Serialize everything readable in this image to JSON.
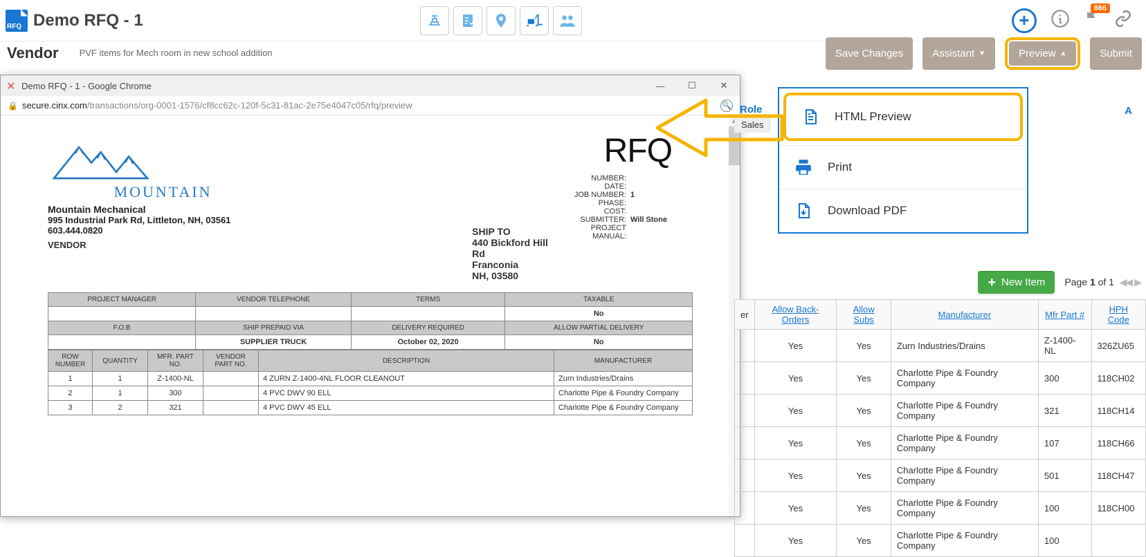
{
  "header": {
    "title": "Demo RFQ - 1",
    "badge_count": "866"
  },
  "sub": {
    "vendor_label": "Vendor",
    "description": "PVF items for Mech room in new school addition"
  },
  "buttons": {
    "save": "Save Changes",
    "assistant": "Assistant",
    "preview": "Preview",
    "submit": "Submit"
  },
  "dropdown": {
    "html_preview": "HTML Preview",
    "print": "Print",
    "download_pdf": "Download PDF"
  },
  "popup": {
    "title": "Demo RFQ - 1 - Google Chrome",
    "url_host": "secure.cinx.com",
    "url_path": "/transactions/org-0001-1576/cf8cc62c-120f-5c31-81ac-2e75e4047c05/rfq/preview"
  },
  "doc": {
    "logo_text": "MOUNTAIN",
    "company_name": "Mountain Mechanical",
    "company_addr": "995 Industrial Park Rd, Littleton, NH, 03561   603.444.0820",
    "vendor_label": "VENDOR",
    "shipto_label": "SHIP TO",
    "ship_addr": "440 Bickford Hill Rd",
    "ship_city": "Franconia",
    "ship_state": "NH, 03580",
    "rfq_heading": "RFQ",
    "fields": {
      "number_lbl": "NUMBER:",
      "date_lbl": "DATE:",
      "job_lbl": "JOB NUMBER:",
      "job_val": "1",
      "phase_lbl": "PHASE:",
      "cost_lbl": "COST:",
      "submitter_lbl": "SUBMITTER:",
      "submitter_val": "Will Stone",
      "manual_lbl": "PROJECT MANUAL:"
    },
    "row1": {
      "h1": "PROJECT MANAGER",
      "h2": "VENDOR TELEPHONE",
      "h3": "TERMS",
      "h4": "TAXABLE",
      "v4": "No"
    },
    "row2": {
      "h1": "F.O.B",
      "h2": "SHIP PREPAID VIA",
      "h3": "DELIVERY REQUIRED",
      "h4": "ALLOW PARTIAL DELIVERY",
      "v2": "SUPPLIER TRUCK",
      "v3": "October 02, 2020",
      "v4": "No"
    },
    "cols": {
      "c1": "ROW NUMBER",
      "c2": "QUANTITY",
      "c3": "MFR. PART NO.",
      "c4": "VENDOR PART NO.",
      "c5": "DESCRIPTION",
      "c6": "MANUFACTURER"
    },
    "rows": [
      {
        "n": "1",
        "q": "1",
        "mfr": "Z-1400-NL",
        "vp": "",
        "desc": "4 ZURN Z-1400-4NL FLOOR CLEANOUT",
        "man": "Zurn Industries/Drains"
      },
      {
        "n": "2",
        "q": "1",
        "mfr": "300",
        "vp": "",
        "desc": "4 PVC DWV 90 ELL",
        "man": "Charlotte Pipe & Foundry Company"
      },
      {
        "n": "3",
        "q": "2",
        "mfr": "321",
        "vp": "",
        "desc": "4 PVC DWV 45 ELL",
        "man": "Charlotte Pipe & Foundry Company"
      }
    ]
  },
  "grid_area": {
    "role_label": "Role",
    "sales_tab": "Sales",
    "acol": "A",
    "new_item": "New Item",
    "page_label_pre": "Page ",
    "page_num": "1",
    "page_of": " of 1",
    "headers": {
      "cut": "er",
      "backorders": "Allow Back-Orders",
      "subs": "Allow Subs",
      "manufacturer": "Manufacturer",
      "mfrpart": "Mfr Part #",
      "hph": "HPH Code"
    },
    "rows": [
      {
        "bo": "Yes",
        "sub": "Yes",
        "man": "Zurn Industries/Drains",
        "part": "Z-1400-NL",
        "hph": "326ZU65"
      },
      {
        "bo": "Yes",
        "sub": "Yes",
        "man": "Charlotte Pipe & Foundry Company",
        "part": "300",
        "hph": "118CH02"
      },
      {
        "bo": "Yes",
        "sub": "Yes",
        "man": "Charlotte Pipe & Foundry Company",
        "part": "321",
        "hph": "118CH14"
      },
      {
        "bo": "Yes",
        "sub": "Yes",
        "man": "Charlotte Pipe & Foundry Company",
        "part": "107",
        "hph": "118CH66"
      },
      {
        "bo": "Yes",
        "sub": "Yes",
        "man": "Charlotte Pipe & Foundry Company",
        "part": "501",
        "hph": "118CH47"
      },
      {
        "bo": "Yes",
        "sub": "Yes",
        "man": "Charlotte Pipe & Foundry Company",
        "part": "100",
        "hph": "118CH00"
      },
      {
        "bo": "Yes",
        "sub": "Yes",
        "man": "Charlotte Pipe & Foundry Company",
        "part": "100",
        "hph": ""
      }
    ]
  }
}
